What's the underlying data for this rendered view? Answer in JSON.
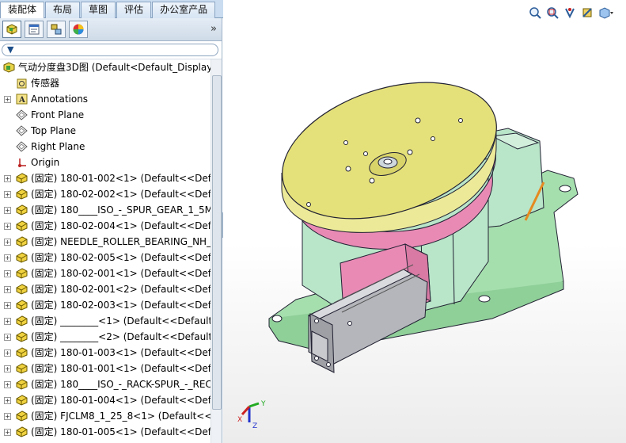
{
  "command_tabs": [
    "装配体",
    "布局",
    "草图",
    "评估",
    "办公室产品"
  ],
  "panel_tabs": [
    {
      "icon": "feature-manager-icon"
    },
    {
      "icon": "property-manager-icon"
    },
    {
      "icon": "configuration-manager-icon"
    },
    {
      "icon": "display-manager-icon"
    }
  ],
  "panel_more": "»",
  "filter": {
    "icon": "filter-icon",
    "value": ""
  },
  "tree": [
    {
      "label": "气动分度盘3D图  (Default<Default_Display",
      "icon": "assembly-icon",
      "expand": "",
      "indent": 0
    },
    {
      "label": "传感器",
      "icon": "sensor-icon",
      "expand": "",
      "indent": 1
    },
    {
      "label": "Annotations",
      "icon": "annotation-icon",
      "expand": "+",
      "indent": 1
    },
    {
      "label": "Front Plane",
      "icon": "plane-icon",
      "expand": "",
      "indent": 1
    },
    {
      "label": "Top Plane",
      "icon": "plane-icon",
      "expand": "",
      "indent": 1
    },
    {
      "label": "Right Plane",
      "icon": "plane-icon",
      "expand": "",
      "indent": 1
    },
    {
      "label": "Origin",
      "icon": "origin-icon",
      "expand": "",
      "indent": 1
    },
    {
      "label": "(固定) 180-01-002<1> (Default<<Defau",
      "icon": "part-icon",
      "expand": "+",
      "indent": 1
    },
    {
      "label": "(固定) 180-02-002<1> (Default<<Defau",
      "icon": "part-icon",
      "expand": "+",
      "indent": 1
    },
    {
      "label": "(固定) 180____ISO_-_SPUR_GEAR_1_5M_",
      "icon": "part-icon",
      "expand": "+",
      "indent": 1
    },
    {
      "label": "(固定) 180-02-004<1> (Default<<Defau",
      "icon": "part-icon",
      "expand": "+",
      "indent": 1
    },
    {
      "label": "(固定) NEEDLE_ROLLER_BEARING_NH_I",
      "icon": "part-icon",
      "expand": "+",
      "indent": 1
    },
    {
      "label": "(固定) 180-02-005<1> (Default<<Defau",
      "icon": "part-icon",
      "expand": "+",
      "indent": 1
    },
    {
      "label": "(固定) 180-02-001<1> (Default<<Defau",
      "icon": "part-icon",
      "expand": "+",
      "indent": 1
    },
    {
      "label": "(固定) 180-02-001<2> (Default<<Defau",
      "icon": "part-icon",
      "expand": "+",
      "indent": 1
    },
    {
      "label": "(固定) 180-02-003<1> (Default<<Defau",
      "icon": "part-icon",
      "expand": "+",
      "indent": 1
    },
    {
      "label": "(固定) ________<1> (Default<<Default:",
      "icon": "part-icon",
      "expand": "+",
      "indent": 1
    },
    {
      "label": "(固定) ________<2> (Default<<Default:",
      "icon": "part-icon",
      "expand": "+",
      "indent": 1
    },
    {
      "label": "(固定) 180-01-003<1> (Default<<Defau",
      "icon": "part-icon",
      "expand": "+",
      "indent": 1
    },
    {
      "label": "(固定) 180-01-001<1> (Default<<Defau",
      "icon": "part-icon",
      "expand": "+",
      "indent": 1
    },
    {
      "label": "(固定) 180____ISO_-_RACK-SPUR_-_REC",
      "icon": "part-icon",
      "expand": "+",
      "indent": 1
    },
    {
      "label": "(固定) 180-01-004<1> (Default<<Defau",
      "icon": "part-icon",
      "expand": "+",
      "indent": 1
    },
    {
      "label": "(固定) FJCLM8_1_25_8<1> (Default<<D",
      "icon": "part-icon",
      "expand": "+",
      "indent": 1
    },
    {
      "label": "(固定) 180-01-005<1> (Default<<Defau",
      "icon": "part-icon",
      "expand": "+",
      "indent": 1
    }
  ],
  "view_tools": [
    "zoom-to-fit-icon",
    "zoom-to-area-icon",
    "previous-view-icon",
    "section-view-icon",
    "view-orientation-icon"
  ],
  "triad": {
    "x": "X",
    "y": "Y",
    "z": "Z"
  },
  "colors": {
    "platter_top": "#e5e17a",
    "platter_side": "#ecea98",
    "pink_ring": "#e98ab5",
    "body_green": "#b9e5c9",
    "base_green": "#a6dfae",
    "cylinder_grey": "#b4b6bb"
  }
}
